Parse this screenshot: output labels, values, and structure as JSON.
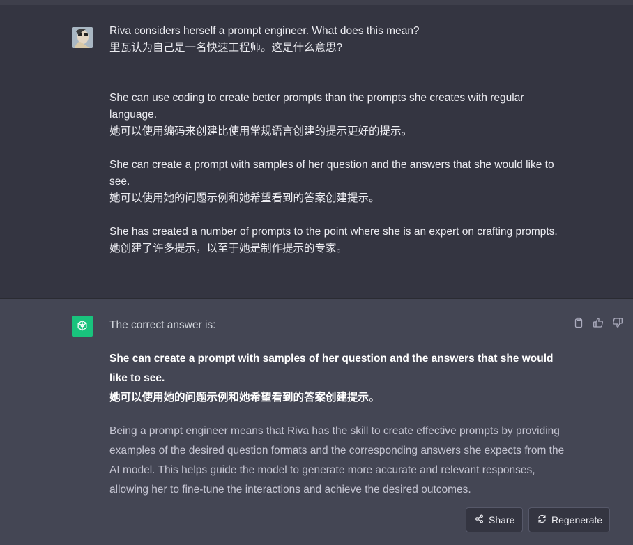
{
  "user_message": {
    "line1": "Riva considers herself a prompt engineer. What does this mean?",
    "line2": "里瓦认为自己是一名快速工程师。这是什么意思?",
    "option1_en": "She can use coding to create better prompts than the prompts she creates with regular language.",
    "option1_zh": "她可以使用编码来创建比使用常规语言创建的提示更好的提示。",
    "option2_en": "She can create a prompt with samples of her question and the answers that she would like to see.",
    "option2_zh": "她可以使用她的问题示例和她希望看到的答案创建提示。",
    "option3_en": "She has created a number of prompts to the point where she is an expert on crafting prompts.",
    "option3_zh": "她创建了许多提示，以至于她是制作提示的专家。"
  },
  "assistant_message": {
    "intro": "The correct answer is:",
    "answer_en": "She can create a prompt with samples of her question and the answers that she would like to see.",
    "answer_zh": "她可以使用她的问题示例和她希望看到的答案创建提示。",
    "explanation": "Being a prompt engineer means that Riva has the skill to create effective prompts by providing examples of the desired question formats and the corresponding answers she expects from the AI model. This helps guide the model to generate more accurate and relevant responses, allowing her to fine-tune the interactions and achieve the desired outcomes."
  },
  "buttons": {
    "share": "Share",
    "regenerate": "Regenerate"
  },
  "icons": {
    "copy": "clipboard-icon",
    "like": "thumbs-up-icon",
    "dislike": "thumbs-down-icon",
    "share": "share-icon",
    "regenerate": "refresh-icon",
    "bot": "openai-logo-icon"
  },
  "colors": {
    "background": "#343541",
    "assistant_background": "#444654",
    "bot_avatar": "#19c37d"
  }
}
